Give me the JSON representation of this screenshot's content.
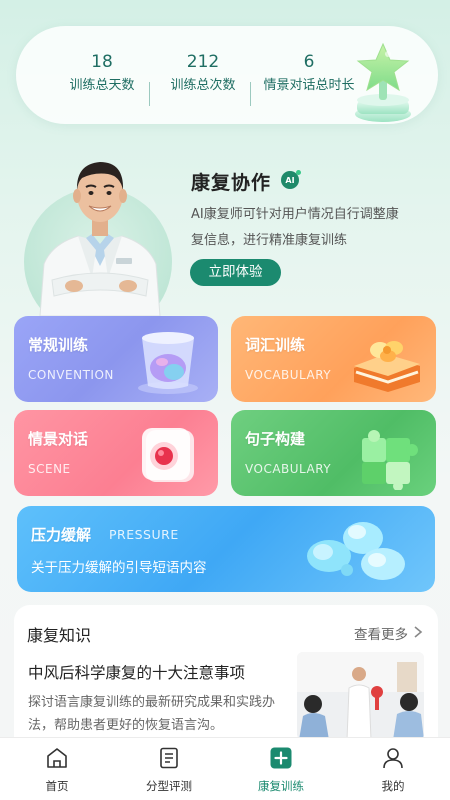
{
  "stats": [
    {
      "value": "18",
      "label": "训练总天数"
    },
    {
      "value": "212",
      "label": "训练总次数"
    },
    {
      "value": "6",
      "label": "情景对话总时长"
    }
  ],
  "coop": {
    "title": "康复协作",
    "badge": "AI",
    "description": "AI康复师可针对用户情况自行调整康复信息，进行精准康复训练",
    "button": "立即体验"
  },
  "cards": [
    {
      "title": "常规训练",
      "subtitle": "CONVENTION",
      "color": "#9aa5f7"
    },
    {
      "title": "词汇训练",
      "subtitle": "VOCABULARY",
      "color": "#ffa15b"
    },
    {
      "title": "情景对话",
      "subtitle": "SCENE",
      "color": "#fc7f92"
    },
    {
      "title": "句子构建",
      "subtitle": "VOCABULARY",
      "color": "#50bd66"
    }
  ],
  "pressure": {
    "title": "压力缓解",
    "subtitle": "PRESSURE",
    "description": "关于压力缓解的引导短语内容",
    "color": "#3fa8f5"
  },
  "knowledge": {
    "title": "康复知识",
    "more": "查看更多",
    "article_title": "中风后科学康复的十大注意事项",
    "article_desc": "探讨语言康复训练的最新研究成果和实践办法，帮助患者更好的恢复语言沟。"
  },
  "nav": [
    {
      "label": "首页",
      "icon": "home-icon"
    },
    {
      "label": "分型评测",
      "icon": "document-icon"
    },
    {
      "label": "康复训练",
      "icon": "plus-square-icon",
      "active": true
    },
    {
      "label": "我的",
      "icon": "user-icon"
    }
  ],
  "colors": {
    "accent": "#1b8a6f",
    "stat_text": "#1f6e63"
  }
}
